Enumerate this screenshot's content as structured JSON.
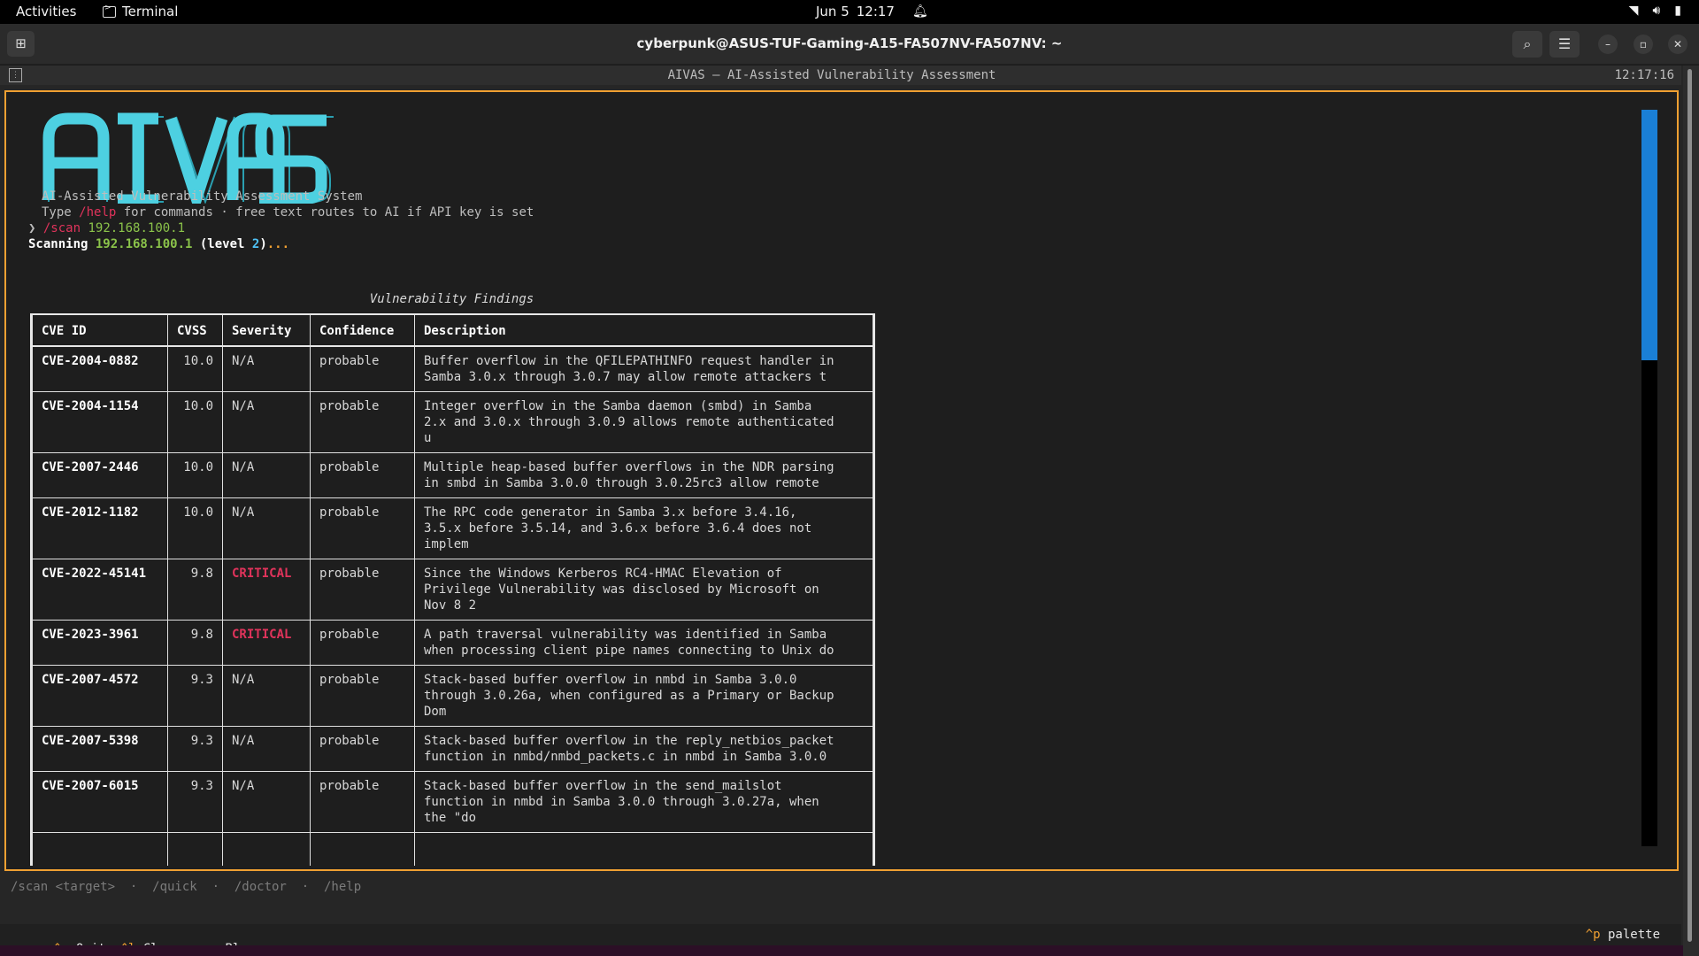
{
  "topbar": {
    "activities": "Activities",
    "app_name": "Terminal",
    "date": "Jun 5",
    "time": "12:17"
  },
  "window": {
    "title": "cyberpunk@ASUS-TUF-Gaming-A15-FA507NV-FA507NV: ~"
  },
  "app": {
    "header_title": "AIVAS — AI-Assisted Vulnerability Assessment",
    "header_clock": "12:17:16",
    "logo_text": "AIVAS",
    "subtitle": "AI-Assisted Vulnerability Assessment System",
    "help_prefix": "Type ",
    "help_cmd": "/help",
    "help_suffix": " for commands · free text routes to AI if API key is set",
    "prompt_symbol": "❯",
    "prompt_cmd": "/scan",
    "prompt_target": " 192.168.100.1",
    "scan_prefix": "Scanning ",
    "scan_target": "192.168.100.1",
    "scan_level_prefix": " (level ",
    "scan_level": "2",
    "scan_level_suffix": ")",
    "scan_dots": "...",
    "table_title": "Vulnerability Findings",
    "columns": [
      "CVE ID",
      "CVSS",
      "Severity",
      "Confidence",
      "Description"
    ],
    "rows": [
      {
        "cve": "CVE-2004-0882",
        "cvss": "10.0",
        "severity": "N/A",
        "confidence": "probable",
        "description": "Buffer overflow in the QFILEPATHINFO request handler in\nSamba 3.0.x through 3.0.7 may allow remote attackers t"
      },
      {
        "cve": "CVE-2004-1154",
        "cvss": "10.0",
        "severity": "N/A",
        "confidence": "probable",
        "description": "Integer overflow in the Samba daemon (smbd) in Samba\n2.x and 3.0.x through 3.0.9 allows remote authenticated\nu"
      },
      {
        "cve": "CVE-2007-2446",
        "cvss": "10.0",
        "severity": "N/A",
        "confidence": "probable",
        "description": "Multiple heap-based buffer overflows in the NDR parsing\nin smbd in Samba 3.0.0 through 3.0.25rc3 allow remote"
      },
      {
        "cve": "CVE-2012-1182",
        "cvss": "10.0",
        "severity": "N/A",
        "confidence": "probable",
        "description": "The RPC code generator in Samba 3.x before 3.4.16,\n3.5.x before 3.5.14, and 3.6.x before 3.6.4 does not\nimplem"
      },
      {
        "cve": "CVE-2022-45141",
        "cvss": "9.8",
        "severity": "CRITICAL",
        "confidence": "probable",
        "description": "Since the Windows Kerberos RC4-HMAC Elevation of\nPrivilege Vulnerability was disclosed by Microsoft on\nNov 8 2"
      },
      {
        "cve": "CVE-2023-3961",
        "cvss": "9.8",
        "severity": "CRITICAL",
        "confidence": "probable",
        "description": "A path traversal vulnerability was identified in Samba\nwhen processing client pipe names connecting to Unix do"
      },
      {
        "cve": "CVE-2007-4572",
        "cvss": "9.3",
        "severity": "N/A",
        "confidence": "probable",
        "description": "Stack-based buffer overflow in nmbd in Samba 3.0.0\nthrough 3.0.26a, when configured as a Primary or Backup\nDom"
      },
      {
        "cve": "CVE-2007-5398",
        "cvss": "9.3",
        "severity": "N/A",
        "confidence": "probable",
        "description": "Stack-based buffer overflow in the reply_netbios_packet\nfunction in nmbd/nmbd_packets.c in nmbd in Samba 3.0.0"
      },
      {
        "cve": "CVE-2007-6015",
        "cvss": "9.3",
        "severity": "N/A",
        "confidence": "probable",
        "description": "Stack-based buffer overflow in the send_mailslot\nfunction in nmbd in Samba 3.0.0 through 3.0.27a, when\nthe \"do"
      },
      {
        "cve": "",
        "cvss": "",
        "severity": "",
        "confidence": "",
        "description": ""
      }
    ],
    "scroll_fraction": 0.34,
    "hints": "/scan <target>  ·  /quick  ·  /doctor  ·  /help",
    "footer_keys": [
      {
        "key": "^c",
        "label": " Quit"
      },
      {
        "key": "^l",
        "label": " Clear"
      },
      {
        "key": "esc",
        "label": " Blur"
      }
    ],
    "palette_key": "^p",
    "palette_label": " palette"
  },
  "colors": {
    "accent_border": "#f0a032",
    "logo": "#4dd0e1",
    "critical": "#e0335b",
    "target_green": "#8bc34a",
    "scroll_thumb": "#1a7fd6"
  },
  "icons": [
    "terminal-icon",
    "bell-icon",
    "wifi-icon",
    "volume-icon",
    "battery-icon",
    "new-tab-icon",
    "search-icon",
    "menu-icon",
    "minimize-icon",
    "maximize-icon",
    "close-icon"
  ]
}
